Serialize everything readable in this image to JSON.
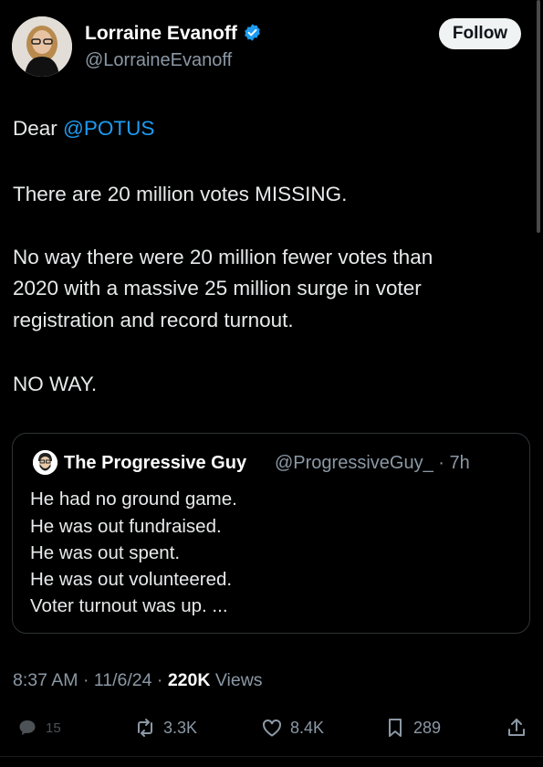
{
  "tweet": {
    "author_name": "Lorraine Evanoff",
    "author_handle": "@LorraineEvanoff",
    "follow_label": "Follow",
    "greeting": "Dear ",
    "mention": "@POTUS",
    "line1": "There are 20 million votes MISSING.",
    "para2": [
      "No way there were 20 million fewer votes than",
      "2020 with a massive 25 million surge in voter",
      "registration and record turnout."
    ],
    "line3": "NO WAY.",
    "time": "8:37 AM · 11/6/24 · ",
    "views_count": "220K",
    "views_label": " Views"
  },
  "quote": {
    "author_name": "The Progressive Guy",
    "author_handle": "@ProgressiveGuy_",
    "age": " · 7h",
    "lines": [
      "He had no ground game.",
      "He was out fundraised.",
      "He was out spent.",
      "He was out volunteered.",
      "Voter turnout was up. ..."
    ]
  },
  "actions": {
    "replies": "15",
    "reposts": "3.3K",
    "likes": "8.4K",
    "bookmarks": "289"
  },
  "colors": {
    "accent": "#1d9bf0",
    "background": "#000000",
    "secondary_text": "#8b98a5"
  }
}
